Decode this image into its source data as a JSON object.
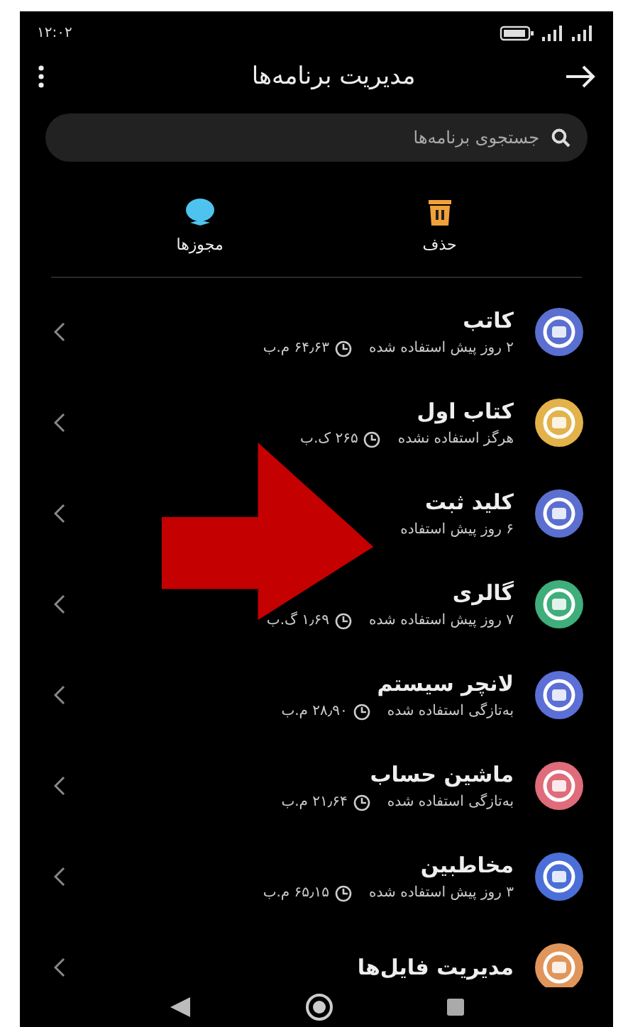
{
  "status_bar": {
    "time": "۱۲:۰۲"
  },
  "header": {
    "title": "مدیریت برنامه‌ها"
  },
  "search": {
    "placeholder": "جستجوی برنامه‌ها"
  },
  "actions": [
    {
      "kind": "delete",
      "label": "حذف"
    },
    {
      "kind": "permissions",
      "label": "مجوزها"
    }
  ],
  "apps": [
    {
      "name": "کاتب",
      "usage": "۲ روز پیش استفاده شده",
      "size": "۶۴٫۶۳ م.ب",
      "color": "#5b6fd0"
    },
    {
      "name": "کتاب اول",
      "usage": "هرگز استفاده نشده",
      "size": "۲۶۵ ک.ب",
      "color": "#e3b24a"
    },
    {
      "name": "کلید ثبت",
      "usage": "۶ روز پیش استفاده",
      "color": "#5b6fd0"
    },
    {
      "name": "گالری",
      "usage": "۷ روز پیش استفاده شده",
      "size": "۱٫۶۹ گ.ب",
      "color": "#3fae7a"
    },
    {
      "name": "لانچر سیستم",
      "usage": "به‌تازگی استفاده شده",
      "size": "۲۸٫۹۰ م.ب",
      "color": "#5b6fd6"
    },
    {
      "name": "ماشین حساب",
      "usage": "به‌تازگی استفاده شده",
      "size": "۲۱٫۶۴ م.ب",
      "color": "#e06b7a"
    },
    {
      "name": "مخاطبین",
      "usage": "۳ روز پیش استفاده شده",
      "size": "۶۵٫۱۵ م.ب",
      "color": "#4a6fd8"
    },
    {
      "name": "مدیریت فایل‌ها",
      "color": "#e0955a"
    }
  ]
}
